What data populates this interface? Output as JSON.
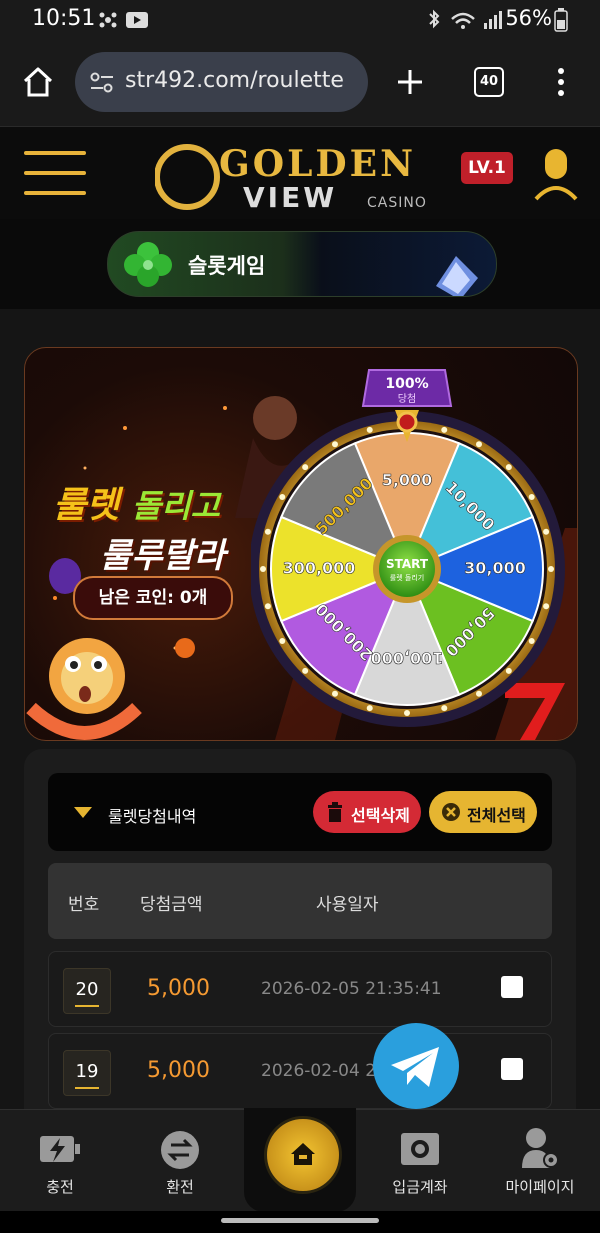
{
  "status": {
    "time": "10:51",
    "battery": "56%"
  },
  "browser": {
    "url": "str492.com/roulette",
    "tab_count": "40"
  },
  "header": {
    "logo_top": "GOLDEN",
    "logo_bottom": "VIEW",
    "logo_suffix": "CASINO",
    "level": "LV.1"
  },
  "submenu": {
    "slot_label": "슬롯게임"
  },
  "banner": {
    "title1a": "룰렛",
    "title1b": "돌리고",
    "title2": "룰루랄라",
    "coins_label": "남은 코인: 0개",
    "wheel_badge": "100%",
    "wheel_badge_sub": "당첨",
    "start_label": "START",
    "start_sub": "룰렛 돌리기",
    "segments": [
      "5,000",
      "10,000",
      "30,000",
      "50,000",
      "100,000",
      "200,000",
      "300,000",
      "500,000"
    ],
    "segment_colors": [
      "#e9a76a",
      "#44c0d8",
      "#1d62df",
      "#6cc021",
      "#d8d8d8",
      "#b15ae0",
      "#ece22b",
      "#7a7a7a"
    ]
  },
  "history": {
    "title": "룰렛당첨내역",
    "delete_label": "선택삭제",
    "select_all_label": "전체선택",
    "columns": [
      "번호",
      "당첨금액",
      "사용일자"
    ],
    "rows": [
      {
        "num": "20",
        "amount": "5,000",
        "date": "2026-02-05 21:35:41"
      },
      {
        "num": "19",
        "amount": "5,000",
        "date": "2026-02-04 21:39:15"
      }
    ]
  },
  "nav": {
    "charge": "충전",
    "exchange": "환전",
    "deposit_account": "입금계좌",
    "mypage": "마이페이지"
  }
}
